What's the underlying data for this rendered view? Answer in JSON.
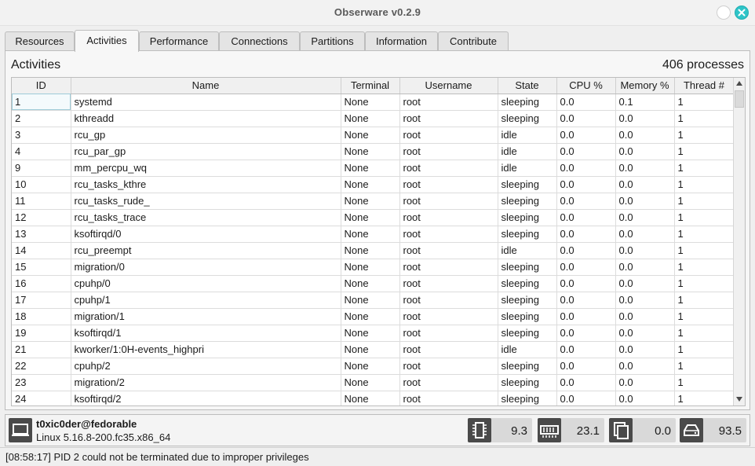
{
  "window": {
    "title": "Obserware v0.2.9"
  },
  "tabs": [
    {
      "label": "Resources"
    },
    {
      "label": "Activities"
    },
    {
      "label": "Performance"
    },
    {
      "label": "Connections"
    },
    {
      "label": "Partitions"
    },
    {
      "label": "Information"
    },
    {
      "label": "Contribute"
    }
  ],
  "active_tab": "Activities",
  "panel": {
    "title": "Activities",
    "count": "406 processes"
  },
  "table": {
    "headers": [
      "ID",
      "Name",
      "Terminal",
      "Username",
      "State",
      "CPU %",
      "Memory %",
      "Thread #"
    ],
    "rows": [
      [
        "1",
        "systemd",
        "None",
        "root",
        "sleeping",
        "0.0",
        "0.1",
        "1"
      ],
      [
        "2",
        "kthreadd",
        "None",
        "root",
        "sleeping",
        "0.0",
        "0.0",
        "1"
      ],
      [
        "3",
        "rcu_gp",
        "None",
        "root",
        "idle",
        "0.0",
        "0.0",
        "1"
      ],
      [
        "4",
        "rcu_par_gp",
        "None",
        "root",
        "idle",
        "0.0",
        "0.0",
        "1"
      ],
      [
        "9",
        "mm_percpu_wq",
        "None",
        "root",
        "idle",
        "0.0",
        "0.0",
        "1"
      ],
      [
        "10",
        "rcu_tasks_kthre",
        "None",
        "root",
        "sleeping",
        "0.0",
        "0.0",
        "1"
      ],
      [
        "11",
        "rcu_tasks_rude_",
        "None",
        "root",
        "sleeping",
        "0.0",
        "0.0",
        "1"
      ],
      [
        "12",
        "rcu_tasks_trace",
        "None",
        "root",
        "sleeping",
        "0.0",
        "0.0",
        "1"
      ],
      [
        "13",
        "ksoftirqd/0",
        "None",
        "root",
        "sleeping",
        "0.0",
        "0.0",
        "1"
      ],
      [
        "14",
        "rcu_preempt",
        "None",
        "root",
        "idle",
        "0.0",
        "0.0",
        "1"
      ],
      [
        "15",
        "migration/0",
        "None",
        "root",
        "sleeping",
        "0.0",
        "0.0",
        "1"
      ],
      [
        "16",
        "cpuhp/0",
        "None",
        "root",
        "sleeping",
        "0.0",
        "0.0",
        "1"
      ],
      [
        "17",
        "cpuhp/1",
        "None",
        "root",
        "sleeping",
        "0.0",
        "0.0",
        "1"
      ],
      [
        "18",
        "migration/1",
        "None",
        "root",
        "sleeping",
        "0.0",
        "0.0",
        "1"
      ],
      [
        "19",
        "ksoftirqd/1",
        "None",
        "root",
        "sleeping",
        "0.0",
        "0.0",
        "1"
      ],
      [
        "21",
        "kworker/1:0H-events_highpri",
        "None",
        "root",
        "idle",
        "0.0",
        "0.0",
        "1"
      ],
      [
        "22",
        "cpuhp/2",
        "None",
        "root",
        "sleeping",
        "0.0",
        "0.0",
        "1"
      ],
      [
        "23",
        "migration/2",
        "None",
        "root",
        "sleeping",
        "0.0",
        "0.0",
        "1"
      ],
      [
        "24",
        "ksoftirqd/2",
        "None",
        "root",
        "sleeping",
        "0.0",
        "0.0",
        "1"
      ]
    ]
  },
  "status": {
    "hostname": "t0xic0der@fedorable",
    "kernel": "Linux 5.16.8-200.fc35.x86_64",
    "metrics": [
      {
        "icon": "cpu-icon",
        "value": "9.3"
      },
      {
        "icon": "memory-icon",
        "value": "23.1"
      },
      {
        "icon": "swap-icon",
        "value": "0.0"
      },
      {
        "icon": "disk-icon",
        "value": "93.5"
      }
    ]
  },
  "message": "[08:58:17] PID 2 could not be terminated due to improper privileges",
  "colors": {
    "close_button": "#2ec4c8",
    "icon_bg": "#4a4a4a",
    "metric_bg": "#d9d9d9"
  }
}
